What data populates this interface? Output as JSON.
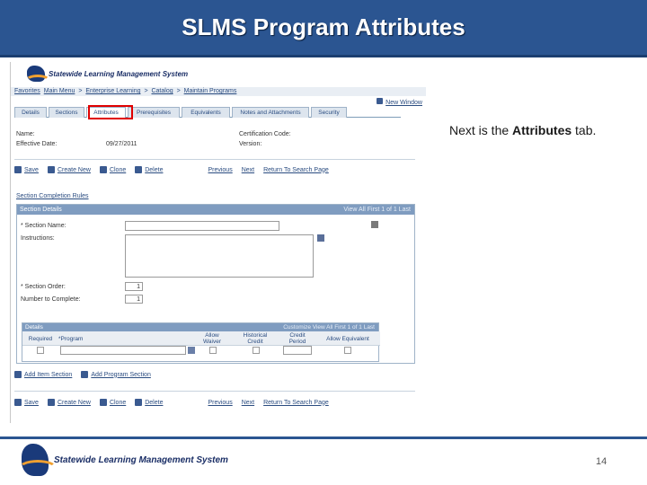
{
  "slide": {
    "title": "SLMS Program Attributes",
    "caption_prefix": "Next is the ",
    "caption_bold": "Attributes",
    "caption_suffix": " tab.",
    "page_number": "14",
    "footer_logo_text": "Statewide Learning Management System",
    "colors": {
      "title_bar": "#2b5591",
      "highlight": "#e00000",
      "link": "#2a4c80"
    }
  },
  "screenshot": {
    "logo_text": "Statewide Learning Management System",
    "breadcrumb": [
      "Favorites",
      "Main Menu",
      ">",
      "Enterprise Learning",
      ">",
      "Catalog",
      ">",
      "Maintain Programs"
    ],
    "new_window": "New Window",
    "tabs": [
      "Details",
      "Sections",
      "Attributes",
      "Prerequisites",
      "Equivalents",
      "Notes and Attachments",
      "Security"
    ],
    "fields": {
      "name_label": "Name:",
      "effective_date_label": "Effective Date:",
      "effective_date_value": "09/27/2011",
      "certification_code_label": "Certification Code:",
      "version_label": "Version:"
    },
    "toolbar": {
      "save": "Save",
      "create_new": "Create New",
      "clone": "Clone",
      "delete": "Delete",
      "previous": "Previous",
      "next": "Next",
      "return_search": "Return To Search Page"
    },
    "section_completion_rules": "Section Completion Rules",
    "section_details": {
      "header": "Section Details",
      "nav": "View All  First  1 of 1  Last",
      "section_name_label": "* Section Name:",
      "instructions_label": "Instructions:",
      "section_order_label": "* Section Order:",
      "section_order_value": "1",
      "number_to_complete_label": "Number to Complete:",
      "number_to_complete_value": "1"
    },
    "details_grid": {
      "header": "Details",
      "nav": "Customize  View All  First  1 of 1  Last",
      "columns": [
        "Required",
        "*Program",
        "Allow Waiver",
        "Historical Credit",
        "Credit Period",
        "Allow Equivalent"
      ]
    },
    "add_item_section": "Add Item Section",
    "add_program_section": "Add Program Section"
  }
}
